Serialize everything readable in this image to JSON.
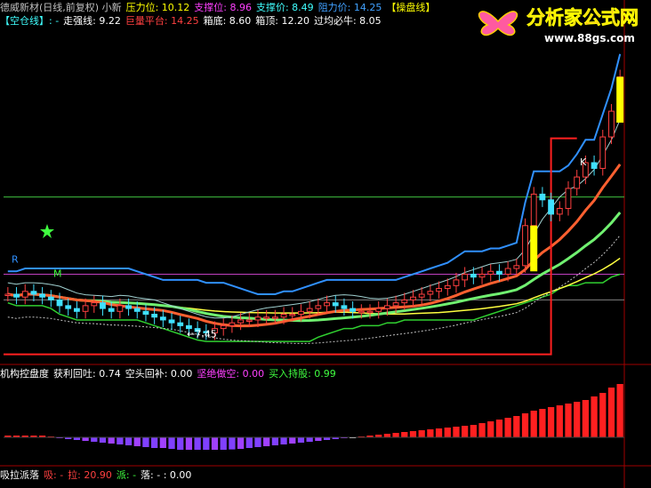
{
  "header": {
    "row1": [
      {
        "text": "德威新材(日线,前复权) 小新",
        "color": "#c0c0c0"
      },
      {
        "text": "压力位: 10.12",
        "color": "#ffff00"
      },
      {
        "text": "支撑位: 8.96",
        "color": "#ff40ff"
      },
      {
        "text": "支撑价: 8.49",
        "color": "#40ffff"
      },
      {
        "text": "阻力价: 14.25",
        "color": "#40a0ff"
      },
      {
        "text": "【操盘线】",
        "color": "#ffff00"
      }
    ],
    "row2": [
      {
        "text": "【空仓线】: -",
        "color": "#40ffff"
      },
      {
        "text": "走强线: 9.22",
        "color": "#ffffff"
      },
      {
        "text": "巨量平台: 14.25",
        "color": "#ff4040"
      },
      {
        "text": "箱底: 8.60",
        "color": "#ffffff"
      },
      {
        "text": "箱顶: 12.20",
        "color": "#ffffff"
      },
      {
        "text": "过均必牛: 8.05",
        "color": "#ffffff"
      }
    ]
  },
  "logo": {
    "title": "分析家公式网",
    "url": "www.88gs.com"
  },
  "markers": {
    "r": "R",
    "m": "M",
    "k": "K",
    "low": "7.45"
  },
  "sub1": {
    "items": [
      {
        "text": "机构控盘度",
        "color": "#ffffff"
      },
      {
        "text": "获利回吐: 0.74",
        "color": "#ffffff"
      },
      {
        "text": "空头回补: 0.00",
        "color": "#ffffff"
      },
      {
        "text": "坚绝做空: 0.00",
        "color": "#ff40ff"
      },
      {
        "text": "买入持股: 0.99",
        "color": "#40ff40"
      }
    ]
  },
  "sub2": {
    "items": [
      {
        "text": "吸拉派落",
        "color": "#ffffff"
      },
      {
        "text": "吸: -",
        "color": "#ff4040"
      },
      {
        "text": "拉: 20.90",
        "color": "#ff4040"
      },
      {
        "text": "派: -",
        "color": "#40ff40"
      },
      {
        "text": "落: - : 0.00",
        "color": "#ffffff"
      }
    ]
  },
  "chart_data": {
    "type": "candlestick",
    "series": [
      {
        "name": "close",
        "values": [
          8.8,
          8.7,
          8.9,
          8.8,
          8.7,
          8.6,
          8.4,
          8.3,
          8.2,
          8.4,
          8.5,
          8.3,
          8.2,
          8.4,
          8.3,
          8.2,
          8.1,
          8.0,
          7.9,
          7.8,
          7.7,
          7.6,
          7.5,
          7.45,
          7.6,
          7.7,
          7.8,
          7.9,
          7.9,
          8.0,
          8.0,
          8.0,
          8.1,
          8.1,
          8.2,
          8.3,
          8.4,
          8.5,
          8.4,
          8.3,
          8.2,
          8.2,
          8.2,
          8.3,
          8.4,
          8.5,
          8.6,
          8.7,
          8.8,
          8.9,
          9.0,
          9.1,
          9.3,
          9.5,
          9.4,
          9.5,
          9.6,
          9.5,
          9.7,
          9.8,
          11.2,
          12.3,
          12.1,
          11.6,
          11.8,
          12.5,
          12.9,
          13.4,
          13.2,
          14.3,
          15.2,
          16.4
        ]
      }
    ],
    "value_labels": {
      "lo": 7.45
    },
    "ylim": [
      6.5,
      18.0
    ],
    "sub1_values": [
      0.1,
      0.1,
      0.1,
      0.1,
      0.1,
      0.05,
      -0.05,
      -0.1,
      -0.15,
      -0.2,
      -0.25,
      -0.3,
      -0.35,
      -0.4,
      -0.45,
      -0.5,
      -0.55,
      -0.6,
      -0.6,
      -0.65,
      -0.7,
      -0.7,
      -0.7,
      -0.7,
      -0.7,
      -0.7,
      -0.68,
      -0.65,
      -0.6,
      -0.55,
      -0.5,
      -0.45,
      -0.4,
      -0.35,
      -0.3,
      -0.25,
      -0.2,
      -0.15,
      -0.1,
      -0.05,
      0.0,
      0.05,
      0.1,
      0.15,
      0.2,
      0.25,
      0.3,
      0.35,
      0.4,
      0.45,
      0.5,
      0.55,
      0.6,
      0.65,
      0.7,
      0.8,
      0.9,
      1.0,
      1.1,
      1.2,
      1.35,
      1.5,
      1.6,
      1.7,
      1.8,
      1.9,
      2.0,
      2.1,
      2.3,
      2.5,
      2.8,
      3.0
    ]
  }
}
